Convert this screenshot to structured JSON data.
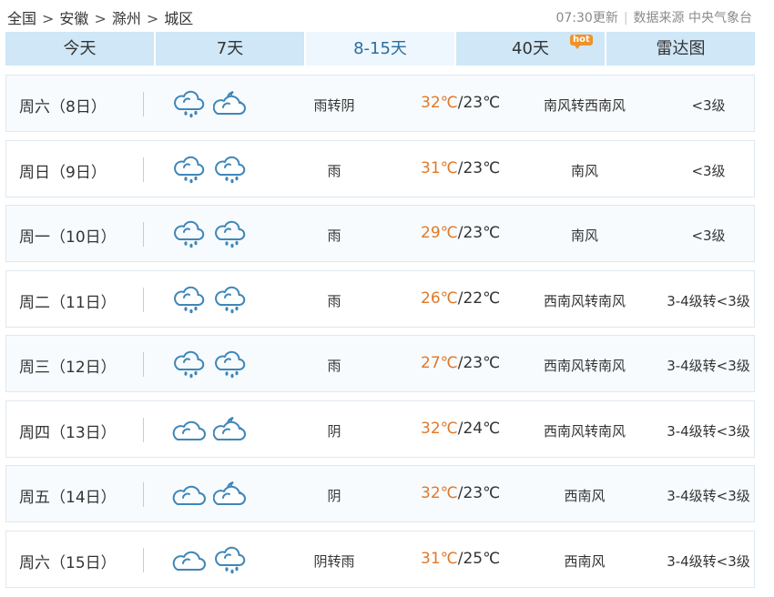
{
  "breadcrumb": {
    "items": [
      "全国",
      "安徽",
      "滁州",
      "城区"
    ],
    "separator": ">"
  },
  "header": {
    "update_time": "07:30更新",
    "source": "数据来源 中央气象台"
  },
  "tabs": [
    {
      "label": "今天",
      "active": false
    },
    {
      "label": "7天",
      "active": false
    },
    {
      "label": "8-15天",
      "active": true
    },
    {
      "label": "40天",
      "active": false,
      "badge": "hot"
    },
    {
      "label": "雷达图",
      "active": false
    }
  ],
  "forecast": [
    {
      "day": "周六（8日）",
      "day_icon": "rain-cloud-icon",
      "night_icon": "cloudy-night-icon",
      "condition": "雨转阴",
      "high": "32℃",
      "low": "23℃",
      "wind": "南风转西南风",
      "level": "<3级"
    },
    {
      "day": "周日（9日）",
      "day_icon": "rain-cloud-icon",
      "night_icon": "rain-cloud-icon",
      "condition": "雨",
      "high": "31℃",
      "low": "23℃",
      "wind": "南风",
      "level": "<3级"
    },
    {
      "day": "周一（10日）",
      "day_icon": "rain-cloud-icon",
      "night_icon": "rain-cloud-icon",
      "condition": "雨",
      "high": "29℃",
      "low": "23℃",
      "wind": "南风",
      "level": "<3级"
    },
    {
      "day": "周二（11日）",
      "day_icon": "rain-cloud-icon",
      "night_icon": "rain-cloud-icon",
      "condition": "雨",
      "high": "26℃",
      "low": "22℃",
      "wind": "西南风转南风",
      "level": "3-4级转<3级"
    },
    {
      "day": "周三（12日）",
      "day_icon": "rain-cloud-icon",
      "night_icon": "rain-cloud-icon",
      "condition": "雨",
      "high": "27℃",
      "low": "23℃",
      "wind": "西南风转南风",
      "level": "3-4级转<3级"
    },
    {
      "day": "周四（13日）",
      "day_icon": "overcast-cloud-icon",
      "night_icon": "cloudy-night-icon",
      "condition": "阴",
      "high": "32℃",
      "low": "24℃",
      "wind": "西南风转南风",
      "level": "3-4级转<3级"
    },
    {
      "day": "周五（14日）",
      "day_icon": "overcast-cloud-icon",
      "night_icon": "cloudy-night-icon",
      "condition": "阴",
      "high": "32℃",
      "low": "23℃",
      "wind": "西南风",
      "level": "3-4级转<3级"
    },
    {
      "day": "周六（15日）",
      "day_icon": "overcast-cloud-icon",
      "night_icon": "rain-cloud-icon",
      "condition": "阴转雨",
      "high": "31℃",
      "low": "25℃",
      "wind": "西南风",
      "level": "3-4级转<3级"
    }
  ],
  "colors": {
    "tab_bg": "#cfe7f7",
    "tab_active_bg": "#eef7fd",
    "high_temp": "#e0782a",
    "icon_stroke": "#3f86b8",
    "hot_badge": "#f0922b"
  }
}
